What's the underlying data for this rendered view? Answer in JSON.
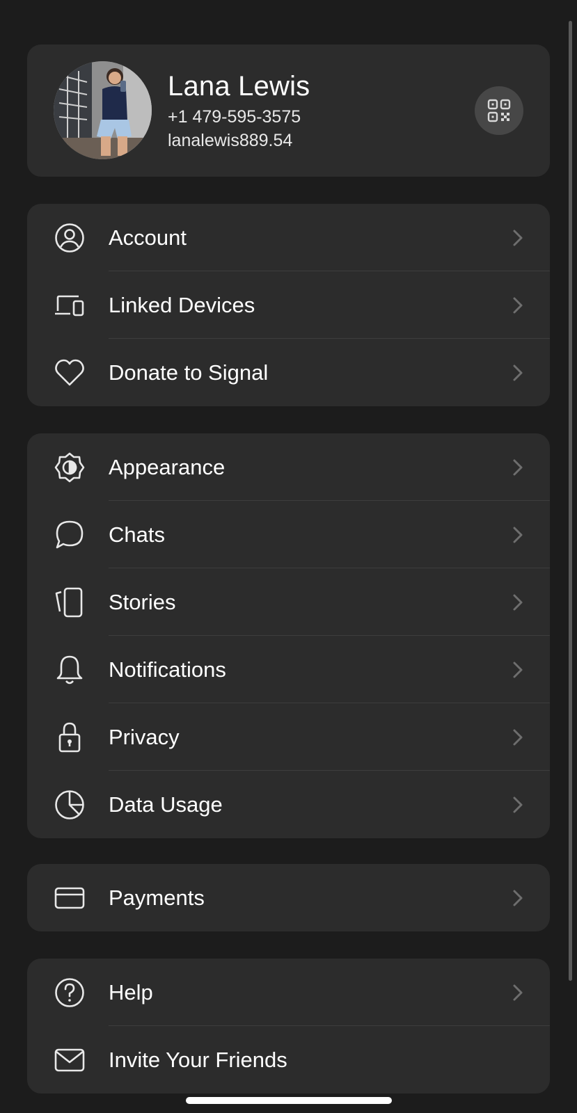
{
  "profile": {
    "name": "Lana Lewis",
    "phone": "+1 479-595-3575",
    "username": "lanalewis889.54"
  },
  "sections": [
    {
      "items": [
        {
          "label": "Account",
          "icon": "person-circle-icon"
        },
        {
          "label": "Linked Devices",
          "icon": "devices-icon"
        },
        {
          "label": "Donate to Signal",
          "icon": "heart-icon"
        }
      ]
    },
    {
      "items": [
        {
          "label": "Appearance",
          "icon": "appearance-icon"
        },
        {
          "label": "Chats",
          "icon": "chat-bubble-icon"
        },
        {
          "label": "Stories",
          "icon": "stories-icon"
        },
        {
          "label": "Notifications",
          "icon": "bell-icon"
        },
        {
          "label": "Privacy",
          "icon": "lock-icon"
        },
        {
          "label": "Data Usage",
          "icon": "pie-chart-icon"
        }
      ]
    },
    {
      "items": [
        {
          "label": "Payments",
          "icon": "credit-card-icon"
        }
      ]
    },
    {
      "items": [
        {
          "label": "Help",
          "icon": "help-icon"
        },
        {
          "label": "Invite Your Friends",
          "icon": "envelope-icon"
        }
      ]
    }
  ],
  "colors": {
    "background": "#1c1c1c",
    "card": "#2c2c2c",
    "text": "#ffffff",
    "chevron": "#6e6e6e"
  }
}
